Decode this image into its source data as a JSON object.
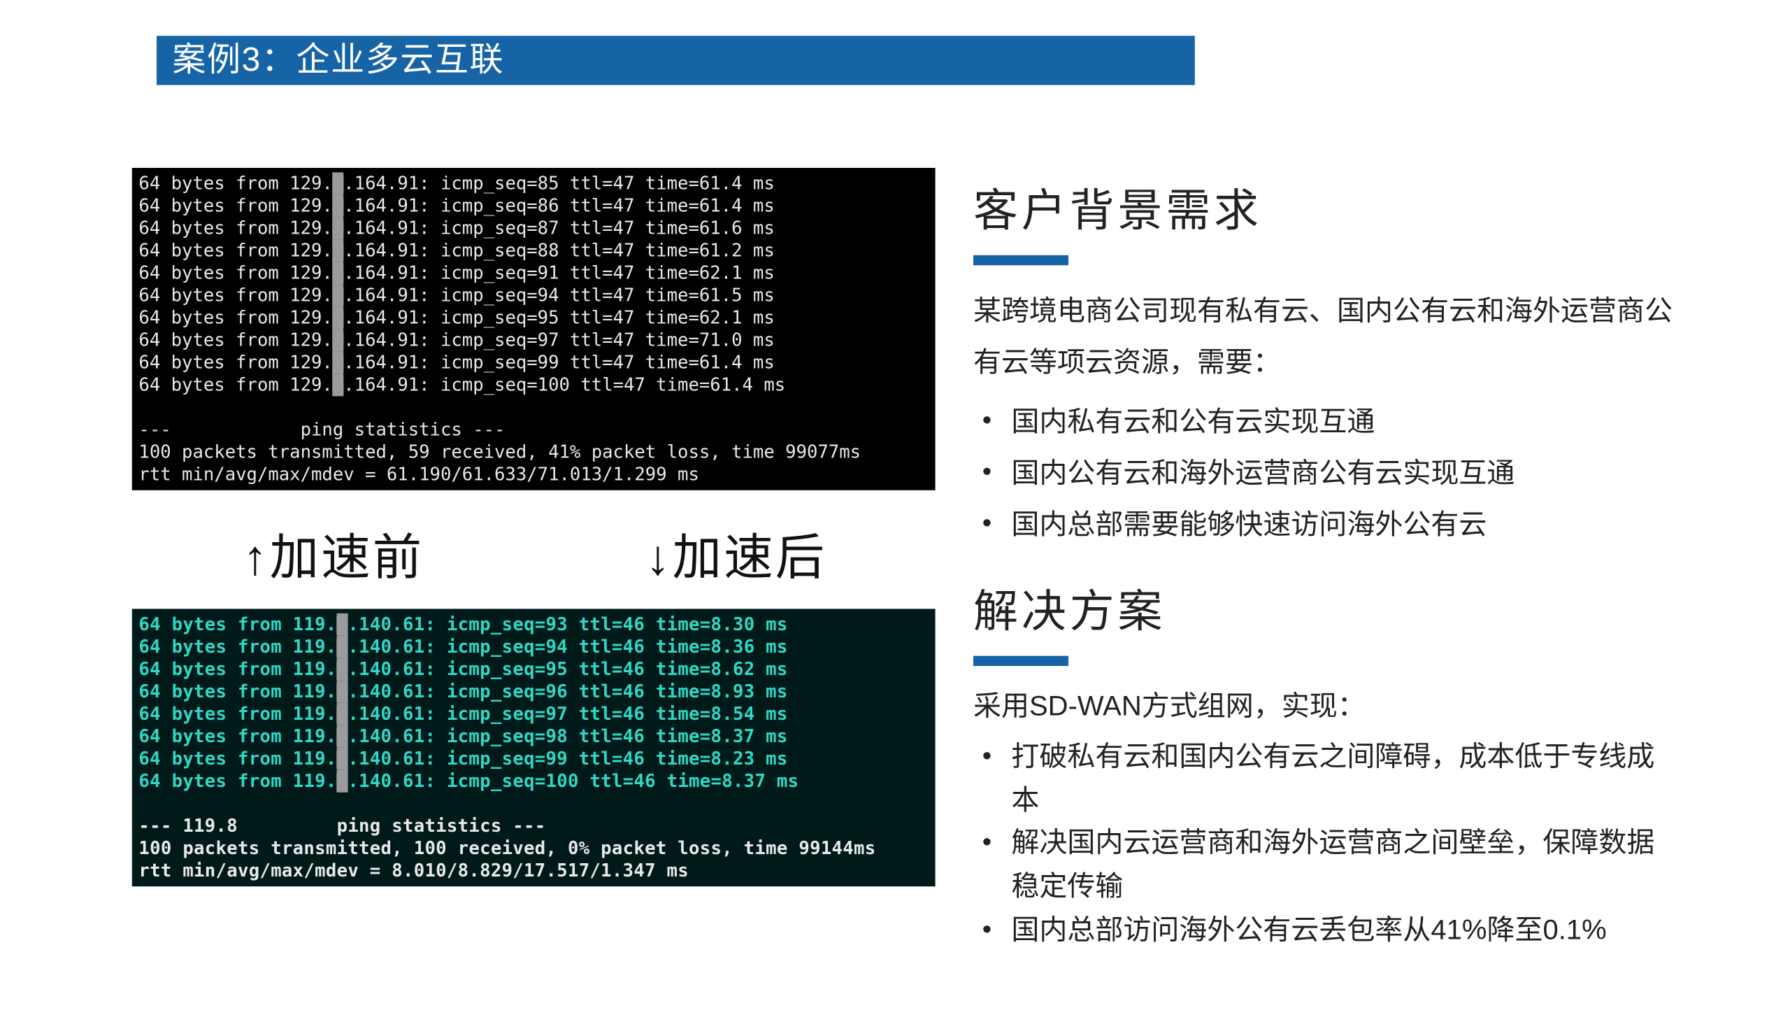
{
  "title": "案例3：企业多云互联",
  "left": {
    "before_caption": "↑加速前",
    "after_caption": "↓加速后",
    "ping_before": {
      "ip_prefix": "129.",
      "ip_suffix": ".164.91",
      "ttl": 47,
      "lines": [
        {
          "seq": 85,
          "time": "61.4"
        },
        {
          "seq": 86,
          "time": "61.4"
        },
        {
          "seq": 87,
          "time": "61.6"
        },
        {
          "seq": 88,
          "time": "61.2"
        },
        {
          "seq": 91,
          "time": "62.1"
        },
        {
          "seq": 94,
          "time": "61.5"
        },
        {
          "seq": 95,
          "time": "62.1"
        },
        {
          "seq": 97,
          "time": "71.0"
        },
        {
          "seq": 99,
          "time": "61.4"
        },
        {
          "seq": 100,
          "time": "61.4"
        }
      ],
      "stats_header": "---            ping statistics ---",
      "stats_line1": "100 packets transmitted, 59 received, 41% packet loss, time 99077ms",
      "stats_line2": "rtt min/avg/max/mdev = 61.190/61.633/71.013/1.299 ms"
    },
    "ping_after": {
      "ip_prefix": "119.",
      "ip_suffix": ".140.61",
      "ttl": 46,
      "lines": [
        {
          "seq": 93,
          "time": "8.30"
        },
        {
          "seq": 94,
          "time": "8.36"
        },
        {
          "seq": 95,
          "time": "8.62"
        },
        {
          "seq": 96,
          "time": "8.93"
        },
        {
          "seq": 97,
          "time": "8.54"
        },
        {
          "seq": 98,
          "time": "8.37"
        },
        {
          "seq": 99,
          "time": "8.23"
        },
        {
          "seq": 100,
          "time": "8.37"
        }
      ],
      "stats_header": "--- 119.8         ping statistics ---",
      "stats_line1": "100 packets transmitted, 100 received, 0% packet loss, time 99144ms",
      "stats_line2": "rtt min/avg/max/mdev = 8.010/8.829/17.517/1.347 ms"
    }
  },
  "right": {
    "sect1_title": "客户背景需求",
    "sect1_para": "某跨境电商公司现有私有云、国内公有云和海外运营商公有云等项云资源，需要：",
    "sect1_bullets": [
      "国内私有云和公有云实现互通",
      "国内公有云和海外运营商公有云实现互通",
      "国内总部需要能够快速访问海外公有云"
    ],
    "sect2_title": "解决方案",
    "sect2_para": "采用SD-WAN方式组网，实现：",
    "sect2_bullets": [
      "打破私有云和国内公有云之间障碍，成本低于专线成本",
      "解决国内云运营商和海外运营商之间壁垒，保障数据稳定传输",
      "国内总部访问海外公有云丢包率从41%降至0.1%"
    ]
  }
}
